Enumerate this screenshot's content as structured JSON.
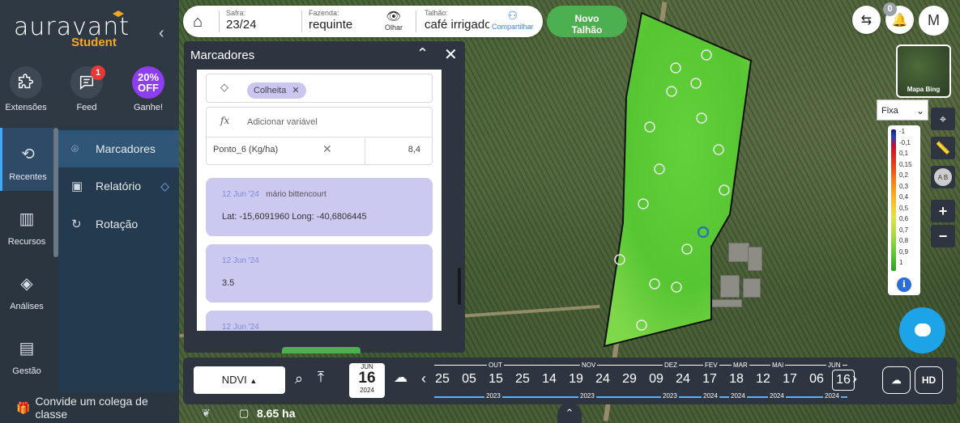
{
  "brand": {
    "name": "auravant",
    "sub": "Student"
  },
  "top_icons": [
    {
      "label": "Extensões",
      "icon": "puzzle-icon"
    },
    {
      "label": "Feed",
      "icon": "feed-icon",
      "badge": "1"
    },
    {
      "label": "Ganhe!",
      "icon": "promo-icon",
      "promo_line1": "20%",
      "promo_line2": "OFF"
    }
  ],
  "left_nav": [
    {
      "label": "Recentes",
      "icon": "recent-icon",
      "active": true
    },
    {
      "label": "Recursos",
      "icon": "resources-icon"
    },
    {
      "label": "Análises",
      "icon": "layers-icon"
    },
    {
      "label": "Gestão",
      "icon": "management-icon"
    }
  ],
  "sub_nav": [
    {
      "label": "Marcadores",
      "icon": "marker-icon",
      "active": true
    },
    {
      "label": "Relatório",
      "icon": "report-icon",
      "premium": true
    },
    {
      "label": "Rotação",
      "icon": "rotation-icon"
    }
  ],
  "invite": {
    "label": "Convide um colega de classe",
    "icon": "gift-icon"
  },
  "header": {
    "safra_label": "Safra:",
    "safra_value": "23/24",
    "fazenda_label": "Fazenda:",
    "fazenda_value": "requinte",
    "olhar_label": "Olhar",
    "talhao_label": "Talhão:",
    "talhao_value": "café irrigado",
    "share_label": "Compartilhar"
  },
  "novo_talhao": {
    "line1": "Novo",
    "line2": "Talhão"
  },
  "marker_panel": {
    "title": "Marcadores",
    "tag_chip": "Colheita",
    "variable_placeholder": "Adicionar variável",
    "variable_name": "Ponto_6 (Kg/ha)",
    "variable_value": "8,4",
    "cards": [
      {
        "date": "12 Jun '24",
        "user": "mário bittencourt",
        "body": "Lat: -15,6091960 Long: -40,6806445"
      },
      {
        "date": "12 Jun '24",
        "user": "",
        "body": "3.5"
      },
      {
        "date": "12 Jun '24",
        "user": "",
        "body": ""
      }
    ]
  },
  "right_controls": {
    "notification_count": "0",
    "avatar_initial": "M",
    "map_thumb_label": "Mapa Bing",
    "scale_select": "Fixa",
    "legend_labels": [
      "-1",
      "-0,1",
      "0,1",
      "0,15",
      "0,2",
      "0,3",
      "0,4",
      "0,5",
      "0,6",
      "0,7",
      "0,8",
      "0,9",
      "1"
    ]
  },
  "timeline": {
    "layer": "NDVI",
    "selected_date": {
      "month": "JUN",
      "day": "16",
      "year": "2024"
    },
    "days": [
      "25",
      "05",
      "15",
      "25",
      "14",
      "19",
      "24",
      "29",
      "09",
      "24",
      "17",
      "18",
      "12",
      "17",
      "06",
      "16"
    ],
    "months": [
      "OUT",
      "NOV",
      "DEZ",
      "FEV",
      "MAR",
      "MAI",
      "JUN"
    ],
    "years": [
      "2023",
      "2023",
      "2023",
      "2024",
      "2024",
      "2024",
      "2024"
    ],
    "hd_label": "HD"
  },
  "area": {
    "value": "8.65 ha"
  },
  "colors": {
    "accent_green": "#4caf50",
    "promo_purple": "#8e3df0",
    "chat_blue": "#1ca3e8"
  }
}
